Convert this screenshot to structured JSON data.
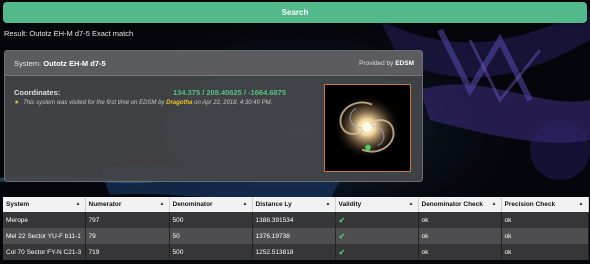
{
  "search": {
    "label": "Search"
  },
  "result": {
    "text": "Result: Outotz EH-M d7-5 Exact match"
  },
  "panel": {
    "system_prefix": "System:",
    "system_name": "Outotz EH-M d7-5",
    "provided_prefix": "Provided by",
    "provider": "EDSM",
    "coordinates_label": "Coordinates:",
    "coordinates_value": "134.375 / 208.40625 / -1664.6875",
    "visit_text": "This system was visited for the first time on EDSM by",
    "visitor": "Dragotha",
    "visit_date": "on Apr 22, 2018, 4:30:40 PM.",
    "star_icon": "star-icon",
    "image_icon": "galaxy-thumbnail"
  },
  "table": {
    "columns": [
      "System",
      "Numerator",
      "Denominator",
      "Distance Ly",
      "Validity",
      "Denominator Check",
      "Precision Check"
    ],
    "rows": [
      {
        "system": "Merope",
        "numerator": "797",
        "denominator": "500",
        "distance": "1388.391534",
        "validity": "✔",
        "denominator_check": "ok",
        "precision_check": "ok"
      },
      {
        "system": "Mel 22 Sector YU-F b11-1",
        "numerator": "79",
        "denominator": "50",
        "distance": "1376.19738",
        "validity": "✔",
        "denominator_check": "ok",
        "precision_check": "ok"
      },
      {
        "system": "Col 70 Sector FY-N C21-3",
        "numerator": "719",
        "denominator": "500",
        "distance": "1252.513818",
        "validity": "✔",
        "denominator_check": "ok",
        "precision_check": "ok"
      }
    ]
  },
  "colors": {
    "accent": "#52b98a",
    "coords": "#58c07c",
    "visitor": "#f0c419",
    "check": "#4cc45f"
  }
}
